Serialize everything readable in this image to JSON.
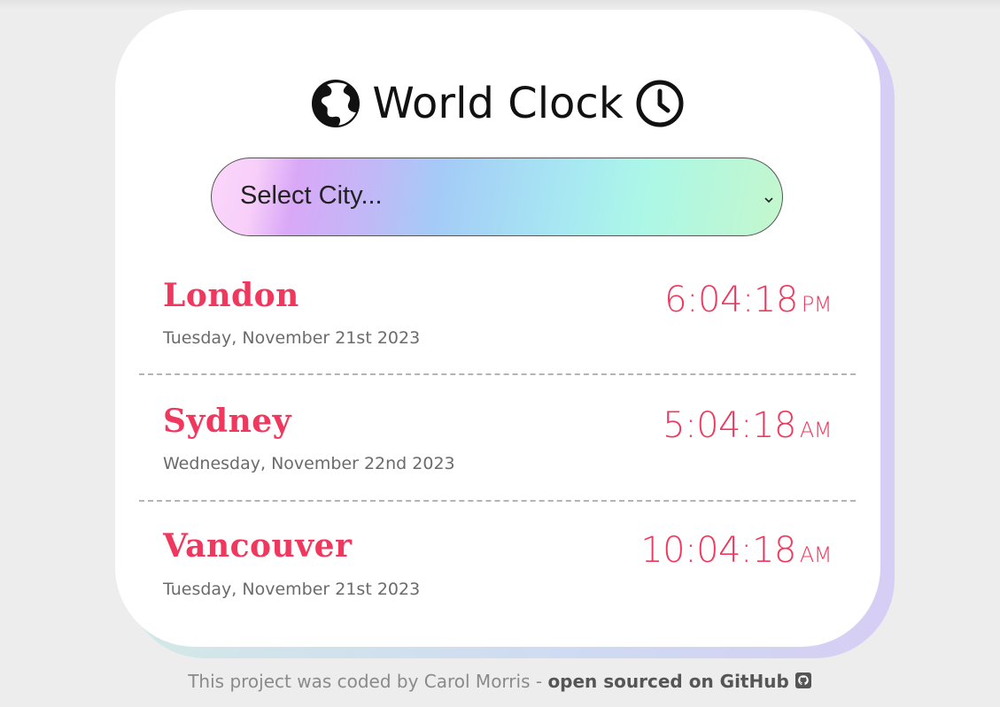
{
  "app": {
    "title": "World Clock"
  },
  "select": {
    "placeholder": "Select City..."
  },
  "cities": [
    {
      "name": "London",
      "date": "Tuesday, November 21st 2023",
      "time": "6:04:18",
      "ampm": "PM"
    },
    {
      "name": "Sydney",
      "date": "Wednesday, November 22nd 2023",
      "time": "5:04:18",
      "ampm": "AM"
    },
    {
      "name": "Vancouver",
      "date": "Tuesday, November 21st 2023",
      "time": "10:04:18",
      "ampm": "AM"
    }
  ],
  "footer": {
    "credit": "This project was coded by Carol Morris - ",
    "link": "open sourced on GitHub"
  },
  "colors": {
    "accent": "#f0385e",
    "background": "#ededed",
    "card": "#ffffff"
  },
  "icons": {
    "title_left": "globe-icon",
    "title_right": "clock-icon",
    "select": "chevron-down-icon",
    "footer": "github-icon"
  }
}
